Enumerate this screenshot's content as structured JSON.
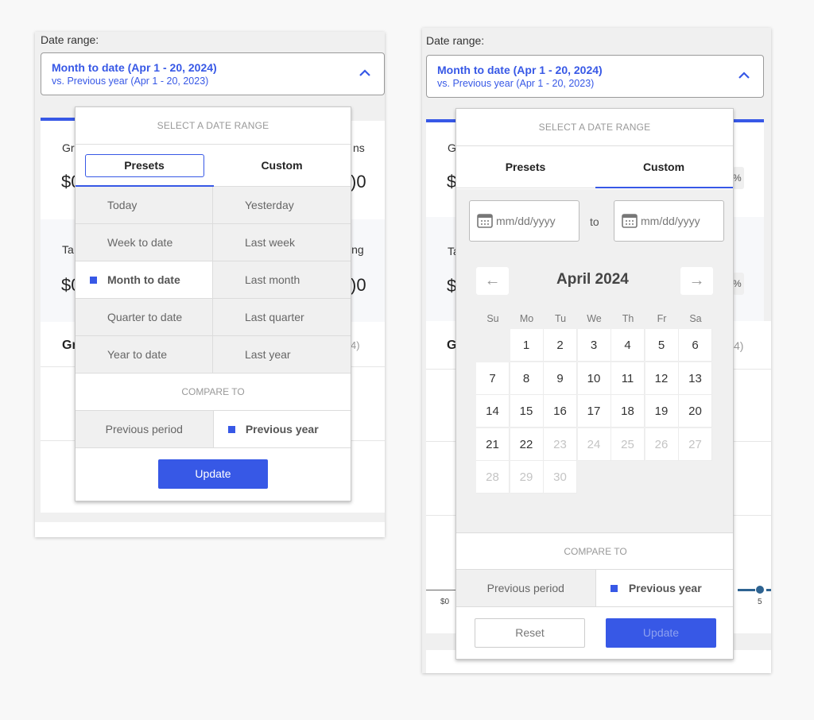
{
  "date_range": {
    "label": "Date range:",
    "selected_main": "Month to date (Apr 1 - 20, 2024)",
    "selected_compare": "vs. Previous year (Apr 1 - 20, 2023)",
    "chevron_icon": "chevron-up-icon"
  },
  "background_dashboard": {
    "card1_label_fragment": "Gr",
    "card1_value_fragment": "$0",
    "card1_right_label_fragment": "ns",
    "card1_right_value_fragment": ")0",
    "card2_label_fragment": "Ta",
    "card2_value_fragment": "$0",
    "card2_right_label_fragment": "ing",
    "card2_right_value_fragment": ")0",
    "section_title_fragment": "Gr",
    "section_right_fragment": "4)",
    "right_card_pill_fragment": "%",
    "chart_axis_label": "$0",
    "chart_x_tick": "5",
    "accent_color": "#3758e6",
    "series_color": "#2e6391"
  },
  "popover": {
    "header": "SELECT A DATE RANGE",
    "tabs": [
      {
        "label": "Presets"
      },
      {
        "label": "Custom"
      }
    ],
    "presets": [
      {
        "label": "Today",
        "selected": false
      },
      {
        "label": "Yesterday",
        "selected": false
      },
      {
        "label": "Week to date",
        "selected": false
      },
      {
        "label": "Last week",
        "selected": false
      },
      {
        "label": "Month to date",
        "selected": true
      },
      {
        "label": "Last month",
        "selected": false
      },
      {
        "label": "Quarter to date",
        "selected": false
      },
      {
        "label": "Last quarter",
        "selected": false
      },
      {
        "label": "Year to date",
        "selected": false
      },
      {
        "label": "Last year",
        "selected": false
      }
    ],
    "compare_header": "COMPARE TO",
    "compare_options": [
      {
        "label": "Previous period",
        "selected": false
      },
      {
        "label": "Previous year",
        "selected": true
      }
    ],
    "update_label": "Update",
    "reset_label": "Reset"
  },
  "custom": {
    "start_placeholder": "mm/dd/yyyy",
    "end_placeholder": "mm/dd/yyyy",
    "to_label": "to",
    "calendar_icon": "calendar-icon",
    "month_title": "April 2024",
    "prev_icon": "arrow-left-icon",
    "next_icon": "arrow-right-icon",
    "prev_glyph": "←",
    "next_glyph": "→",
    "weekdays": [
      "Su",
      "Mo",
      "Tu",
      "We",
      "Th",
      "Fr",
      "Sa"
    ],
    "first_weekday_index": 1,
    "days": [
      "1",
      "2",
      "3",
      "4",
      "5",
      "6",
      "7",
      "8",
      "9",
      "10",
      "11",
      "12",
      "13",
      "14",
      "15",
      "16",
      "17",
      "18",
      "19",
      "20",
      "21",
      "22",
      "23",
      "24",
      "25",
      "26",
      "27",
      "28",
      "29",
      "30"
    ],
    "last_enabled_day": 22
  },
  "theme": {
    "accent": "#3758e6",
    "muted_tile": "#f0f0f0",
    "disabled_day": "#c4c4c4"
  }
}
